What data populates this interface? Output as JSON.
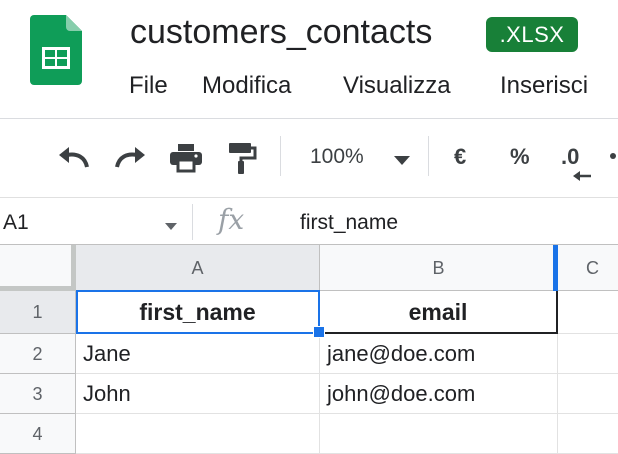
{
  "app": {
    "title": "customers_contacts",
    "badge": ".XLSX",
    "logo_icon": "google-sheets-logo-icon",
    "accent_color": "#188038"
  },
  "menu": [
    "File",
    "Modifica",
    "Visualizza",
    "Inserisci"
  ],
  "toolbar": {
    "icons": [
      "undo-icon",
      "redo-icon",
      "print-icon",
      "paint-format-icon"
    ],
    "zoom": "100%",
    "currency": "€",
    "percent": "%",
    "decimal_decrease": ".0"
  },
  "formula_bar": {
    "cell_ref": "A1",
    "fx": "fx",
    "value": "first_name"
  },
  "grid": {
    "columns": [
      "A",
      "B",
      "C"
    ],
    "rows": [
      "1",
      "2",
      "3",
      "4"
    ],
    "cells": [
      [
        "first_name",
        "email"
      ],
      [
        "Jane",
        "jane@doe.com"
      ],
      [
        "John",
        "john@doe.com"
      ]
    ],
    "selected_cell": "A1",
    "selection_color": "#1a73e8"
  }
}
